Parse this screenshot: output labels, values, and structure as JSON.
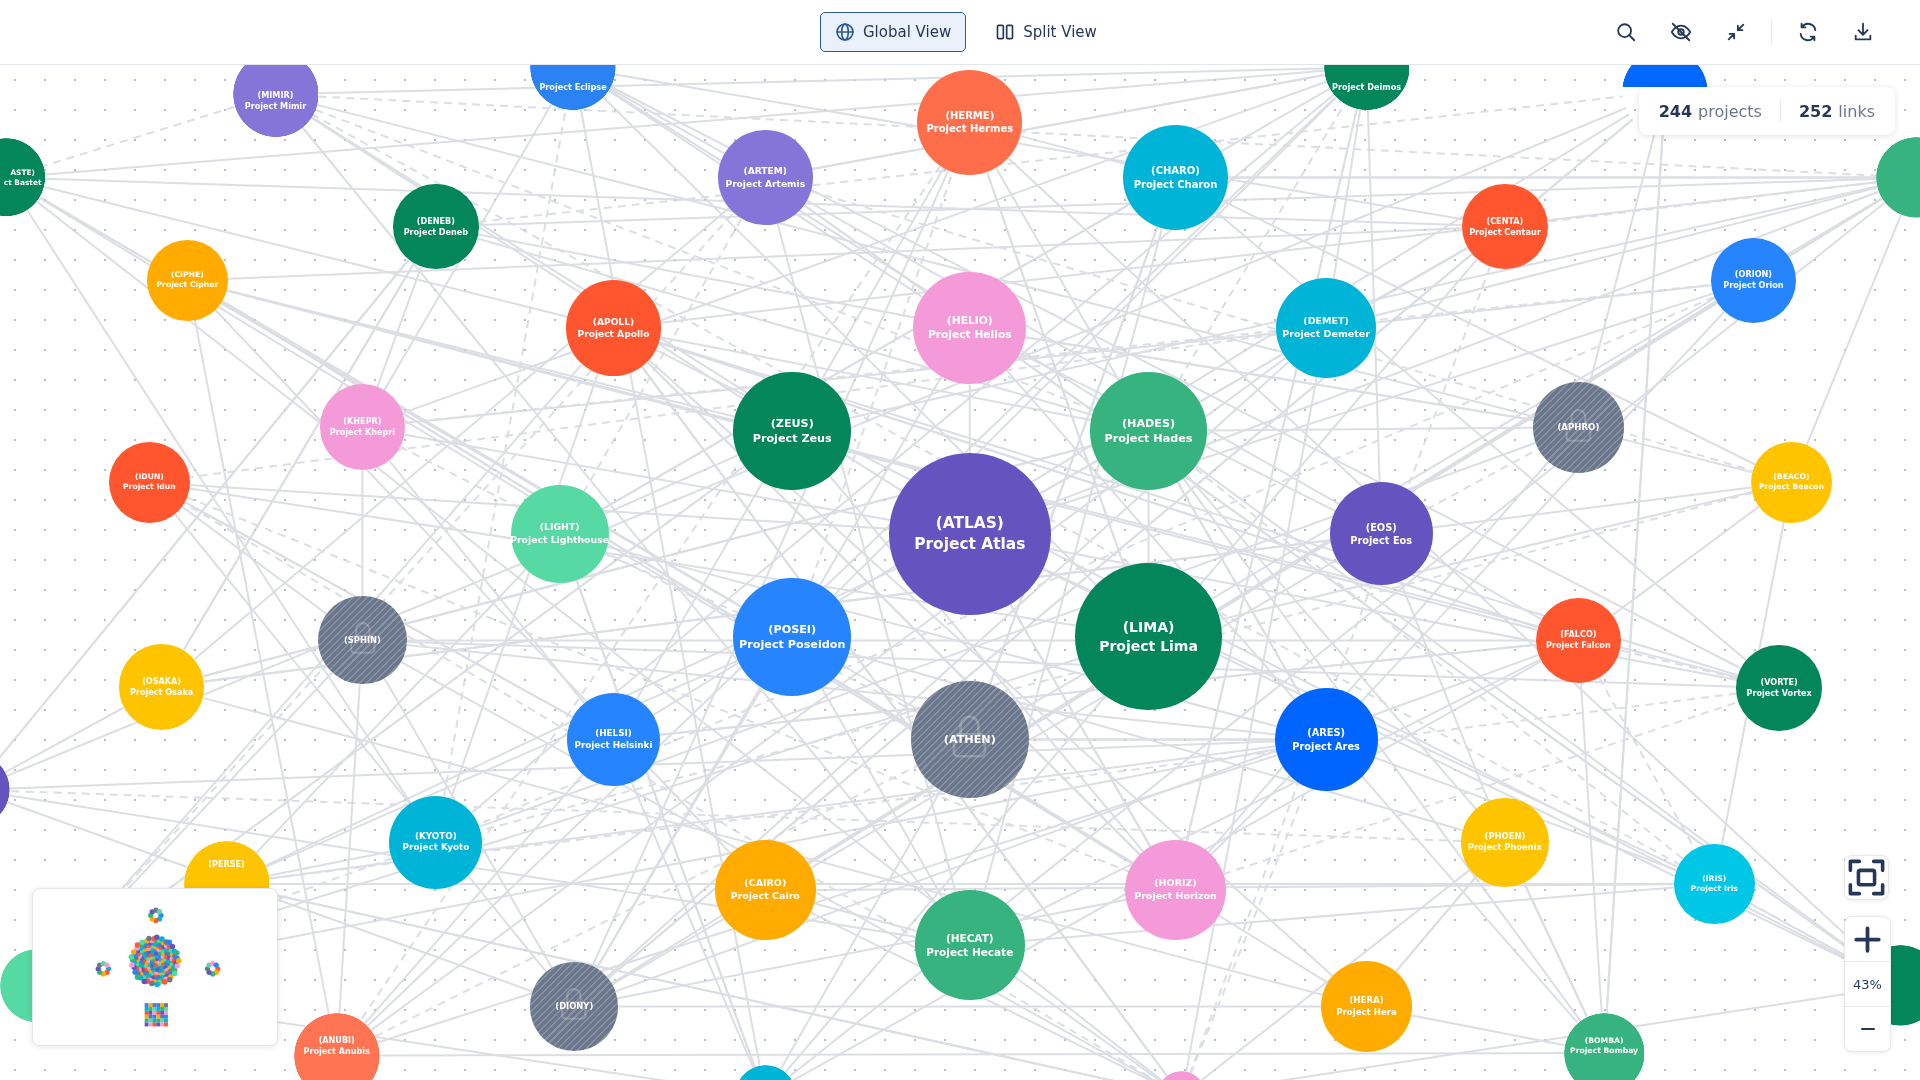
{
  "view_tabs": [
    {
      "kind": "globe",
      "label": "Global View",
      "selected": true
    },
    {
      "kind": "columns",
      "label": "Split View",
      "selected": false
    }
  ],
  "stats": {
    "projects_count": "244",
    "projects_label": "projects",
    "links_count": "252",
    "links_label": "links"
  },
  "nodes": [
    {
      "code": "(MIMIR)",
      "name": "Project Mimir",
      "color": "#8575d8",
      "locked": false
    },
    {
      "name": "Project Eclipse",
      "color": "#2a82f5",
      "locked": false
    },
    {
      "code": "(HERME)",
      "name": "Project Hermes",
      "color": "#ff6e4a",
      "locked": false
    },
    {
      "name": "Project Deimos",
      "color": "#03865a",
      "locked": false
    },
    {
      "color": "#0068ff",
      "locked": false
    },
    {
      "code": "ASTE)",
      "name": "ct Bastet",
      "color": "#03865a",
      "locked": false
    },
    {
      "code": "(ARTEM)",
      "name": "Project Artemis",
      "color": "#8575d8",
      "locked": false
    },
    {
      "code": "(CHARO)",
      "name": "Project Charon",
      "color": "#00b4d8",
      "locked": false
    },
    {
      "color": "#36b37e",
      "locked": false
    },
    {
      "code": "(DENEB)",
      "name": "Project Deneb",
      "color": "#03865a",
      "locked": false
    },
    {
      "code": "(CENTA)",
      "name": "Project Centaur",
      "color": "#ff5630",
      "locked": false
    },
    {
      "code": "(CIPHE)",
      "name": "Project Cipher",
      "color": "#ffab00",
      "locked": false
    },
    {
      "code": "(ORION)",
      "name": "Project Orion",
      "color": "#2684ff",
      "locked": false
    },
    {
      "code": "(APOLL)",
      "name": "Project Apollo",
      "color": "#ff5630",
      "locked": false
    },
    {
      "code": "(HELIO)",
      "name": "Project Helios",
      "color": "#f59ad9",
      "locked": false
    },
    {
      "code": "(DEMET)",
      "name": "Project Demeter",
      "color": "#00b4d8",
      "locked": false
    },
    {
      "code": "(KHEPR)",
      "name": "Project Khepri",
      "color": "#f59ad9",
      "locked": false
    },
    {
      "code": "(ZEUS)",
      "name": "Project Zeus",
      "color": "#03865a",
      "locked": false
    },
    {
      "code": "(HADES)",
      "name": "Project Hades",
      "color": "#36b37e",
      "locked": false
    },
    {
      "code": "(APHRO)",
      "color": "#6b778c",
      "locked": true
    },
    {
      "code": "(IDUN)",
      "name": "Project Idun",
      "color": "#ff5630",
      "locked": false
    },
    {
      "code": "(BEACO)",
      "name": "Project Beacon",
      "color": "#ffc400",
      "locked": false
    },
    {
      "code": "(LIGHT)",
      "name": "Project Lighthouse",
      "color": "#57d9a3",
      "locked": false
    },
    {
      "code": "(ATLAS)",
      "name": "Project Atlas",
      "color": "#6554c0",
      "locked": false
    },
    {
      "code": "(EOS)",
      "name": "Project Eos",
      "color": "#6554c0",
      "locked": false
    },
    {
      "code": "(SPHIN)",
      "color": "#6b778c",
      "locked": true
    },
    {
      "code": "(POSEI)",
      "name": "Project Poseidon",
      "color": "#2684ff",
      "locked": false
    },
    {
      "code": "(LIMA)",
      "name": "Project Lima",
      "color": "#03865a",
      "locked": false
    },
    {
      "code": "(FALCO)",
      "name": "Project Falcon",
      "color": "#ff5630",
      "locked": false
    },
    {
      "code": "(OSAKA)",
      "name": "Project Osaka",
      "color": "#ffc400",
      "locked": false
    },
    {
      "code": "(VORTE)",
      "name": "Project Vortex",
      "color": "#03865a",
      "locked": false
    },
    {
      "code": "(HELSI)",
      "name": "Project Helsinki",
      "color": "#2684ff",
      "locked": false
    },
    {
      "code": "(ATHEN)",
      "color": "#6b778c",
      "locked": true
    },
    {
      "code": "(ARES)",
      "name": "Project Ares",
      "color": "#0065ff",
      "locked": false
    },
    {
      "color": "#6554c0",
      "locked": false
    },
    {
      "code": "(PERSE)",
      "color": "#ffc400",
      "locked": false
    },
    {
      "code": "(KYOTO)",
      "name": "Project Kyoto",
      "color": "#00b4d8",
      "locked": false
    },
    {
      "code": "(CAIRO)",
      "name": "Project Cairo",
      "color": "#ffab00",
      "locked": false
    },
    {
      "code": "(HORIZ)",
      "name": "Project Horizon",
      "color": "#f59ad9",
      "locked": false
    },
    {
      "code": "(PHOEN)",
      "name": "Project Phoenix",
      "color": "#ffc400",
      "locked": false
    },
    {
      "code": "(IRIS)",
      "name": "Project Iris",
      "color": "#00c7e6",
      "locked": false
    },
    {
      "code": "(HECAT)",
      "name": "Project Hecate",
      "color": "#36b37e",
      "locked": false
    },
    {
      "color": "#57d9a3",
      "locked": false
    },
    {
      "code": "(DIONY)",
      "color": "#6b778c",
      "locked": true
    },
    {
      "code": "(HERA)",
      "name": "Project Hera",
      "color": "#ffab00",
      "locked": false
    },
    {
      "color": "#03865a",
      "locked": false
    },
    {
      "code": "(ANUBI)",
      "name": "Project Anubis",
      "color": "#ff7452",
      "locked": false
    },
    {
      "color": "#00b4d8",
      "locked": false
    },
    {
      "color": "#f59ad9",
      "locked": false
    },
    {
      "code": "(BOMBA)",
      "name": "Project Bombay",
      "color": "#36b37e",
      "locked": false
    }
  ],
  "zoom": {
    "reading": "43%"
  }
}
